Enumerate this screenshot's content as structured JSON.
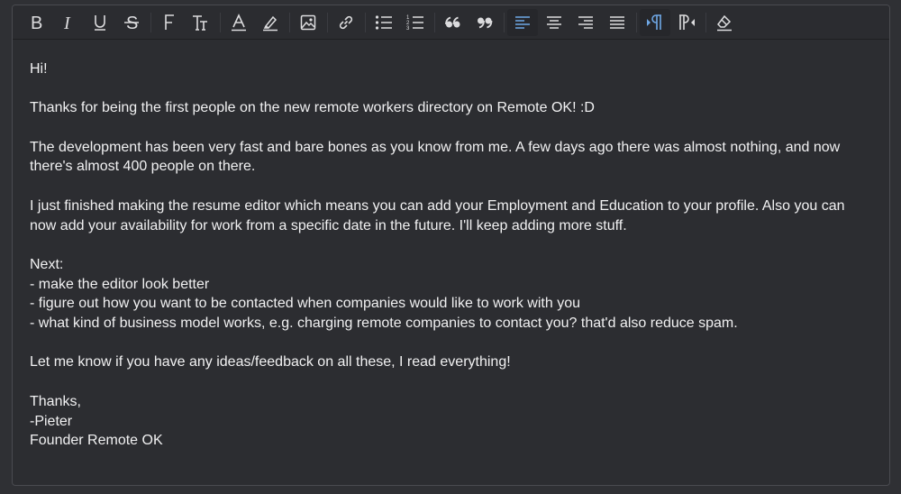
{
  "toolbar": {
    "buttons": [
      {
        "name": "bold-icon",
        "glyph": "B"
      },
      {
        "name": "italic-icon",
        "glyph": "I"
      },
      {
        "name": "underline-icon",
        "glyph": "U"
      },
      {
        "name": "strikethrough-icon",
        "glyph": "S"
      },
      {
        "name": "font-family-icon",
        "glyph": "F"
      },
      {
        "name": "font-size-icon",
        "glyph": "TT"
      },
      {
        "name": "text-color-icon",
        "glyph": "A"
      },
      {
        "name": "highlight-icon",
        "glyph": "marker"
      },
      {
        "name": "image-icon",
        "glyph": "image"
      },
      {
        "name": "link-icon",
        "glyph": "link"
      },
      {
        "name": "bullet-list-icon",
        "glyph": "ul"
      },
      {
        "name": "numbered-list-icon",
        "glyph": "ol"
      },
      {
        "name": "quote-open-icon",
        "glyph": "66"
      },
      {
        "name": "quote-close-icon",
        "glyph": "99"
      },
      {
        "name": "align-left-icon",
        "glyph": "al",
        "active": true
      },
      {
        "name": "align-center-icon",
        "glyph": "ac"
      },
      {
        "name": "align-right-icon",
        "glyph": "ar"
      },
      {
        "name": "justify-icon",
        "glyph": "aj"
      },
      {
        "name": "ltr-direction-icon",
        "glyph": "ltr",
        "active": true
      },
      {
        "name": "rtl-direction-icon",
        "glyph": "rtl"
      },
      {
        "name": "clear-format-icon",
        "glyph": "eraser"
      }
    ],
    "accent_color": "#6fa8e6"
  },
  "document": {
    "line1": "Hi!",
    "line2": "Thanks for being the first people on the new remote workers directory on Remote OK! :D",
    "line3": "The development has been very fast and bare bones as you know from me. A few days ago there was almost nothing, and now",
    "line4": "there's almost 400 people on there.",
    "line5": "I just finished making the resume editor which means you can add your Employment and Education to your profile. Also you can",
    "line6": "now add your availability for work from a specific date in the future. I'll keep adding more stuff.",
    "line7": "Next:",
    "line8": "- make the editor look better",
    "line9": "- figure out how you want to be contacted when companies would like to work with you",
    "line10": "- what kind of business model works, e.g. charging remote companies to contact you? that'd also reduce spam.",
    "line11": "Let me know if you have any ideas/feedback on all these, I read everything!",
    "line12": "Thanks,",
    "line13": "-Pieter",
    "line14": "Founder Remote OK"
  }
}
